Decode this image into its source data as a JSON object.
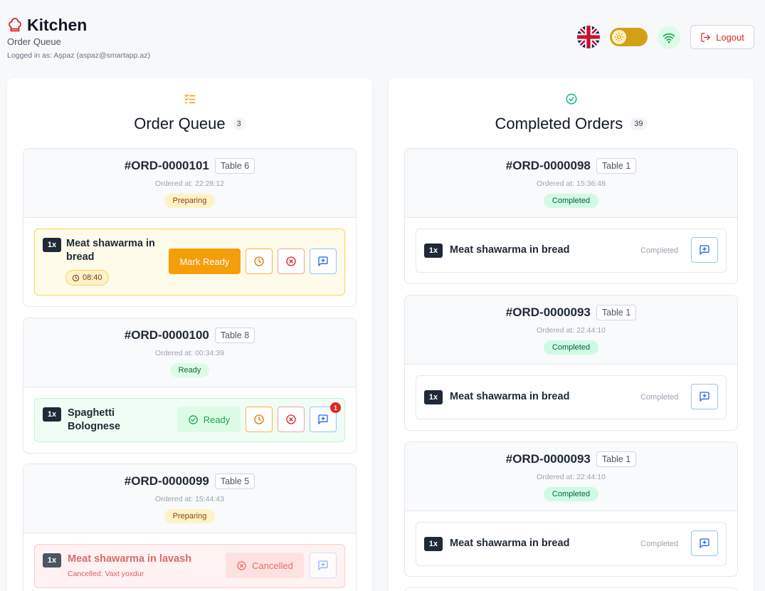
{
  "header": {
    "title": "Kitchen",
    "subtitle": "Order Queue",
    "user_label": "Logged in as: Aşpaz (aspaz@smartapp.az)",
    "logout_label": "Logout",
    "language": "EN",
    "theme": "light",
    "connection": "online"
  },
  "queue": {
    "title": "Order Queue",
    "count": "3",
    "orders": [
      {
        "id": "#ORD-0000101",
        "table": "Table 6",
        "ordered_at": "Ordered at: 22:28:12",
        "status": "Preparing",
        "items": [
          {
            "qty": "1x",
            "name": "Meat shawarma in bread",
            "timer": "08:40",
            "action_label": "Mark Ready"
          }
        ]
      },
      {
        "id": "#ORD-0000100",
        "table": "Table 8",
        "ordered_at": "Ordered at: 00:34:39",
        "status": "Ready",
        "items": [
          {
            "qty": "1x",
            "name": "Spaghetti Bolognese",
            "action_label": "Ready",
            "notes_count": "1"
          }
        ]
      },
      {
        "id": "#ORD-0000099",
        "table": "Table 5",
        "ordered_at": "Ordered at: 15:44:43",
        "status": "Preparing",
        "items": [
          {
            "qty": "1x",
            "name": "Meat shawarma in lavash",
            "cancel_reason": "Cancelled: Vaxt yoxdur",
            "action_label": "Cancelled"
          }
        ]
      }
    ]
  },
  "completed": {
    "title": "Completed Orders",
    "count": "39",
    "orders": [
      {
        "id": "#ORD-0000098",
        "table": "Table 1",
        "ordered_at": "Ordered at: 15:36:48",
        "status": "Completed",
        "items": [
          {
            "qty": "1x",
            "name": "Meat shawarma in bread",
            "state": "Completed"
          }
        ]
      },
      {
        "id": "#ORD-0000093",
        "table": "Table 1",
        "ordered_at": "Ordered at: 22:44:10",
        "status": "Completed",
        "items": [
          {
            "qty": "1x",
            "name": "Meat shawarma in bread",
            "state": "Completed"
          }
        ]
      },
      {
        "id": "#ORD-0000093",
        "table": "Table 1",
        "ordered_at": "Ordered at: 22:44:10",
        "status": "Completed",
        "items": [
          {
            "qty": "1x",
            "name": "Meat shawarma in bread",
            "state": "Completed"
          }
        ]
      }
    ]
  },
  "colors": {
    "accent": "#f59e0b",
    "danger": "#dc2626",
    "success": "#16a34a",
    "info": "#3b82f6"
  },
  "icons": [
    "chef-hat-icon",
    "uk-flag-icon",
    "sun-icon",
    "wifi-icon",
    "logout-icon",
    "list-check-icon",
    "check-circle-icon",
    "clock-icon",
    "x-circle-icon",
    "message-plus-icon"
  ]
}
